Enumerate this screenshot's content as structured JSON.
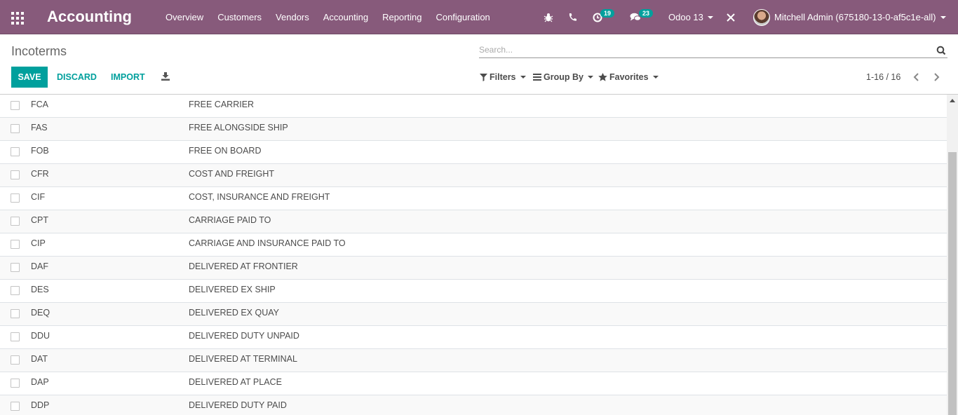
{
  "navbar": {
    "brand": "Accounting",
    "menu": [
      "Overview",
      "Customers",
      "Vendors",
      "Accounting",
      "Reporting",
      "Configuration"
    ],
    "activity_count": "19",
    "message_count": "23",
    "company": "Odoo 13",
    "user": "Mitchell Admin (675180-13-0-af5c1e-all)"
  },
  "control_panel": {
    "breadcrumb": "Incoterms",
    "search_placeholder": "Search...",
    "save_label": "SAVE",
    "discard_label": "DISCARD",
    "import_label": "IMPORT",
    "filters_label": "Filters",
    "groupby_label": "Group By",
    "favorites_label": "Favorites",
    "pager": "1-16 / 16"
  },
  "rows": [
    {
      "code": "FCA",
      "name": "FREE CARRIER"
    },
    {
      "code": "FAS",
      "name": "FREE ALONGSIDE SHIP"
    },
    {
      "code": "FOB",
      "name": "FREE ON BOARD"
    },
    {
      "code": "CFR",
      "name": "COST AND FREIGHT"
    },
    {
      "code": "CIF",
      "name": "COST, INSURANCE AND FREIGHT"
    },
    {
      "code": "CPT",
      "name": "CARRIAGE PAID TO"
    },
    {
      "code": "CIP",
      "name": "CARRIAGE AND INSURANCE PAID TO"
    },
    {
      "code": "DAF",
      "name": "DELIVERED AT FRONTIER"
    },
    {
      "code": "DES",
      "name": "DELIVERED EX SHIP"
    },
    {
      "code": "DEQ",
      "name": "DELIVERED EX QUAY"
    },
    {
      "code": "DDU",
      "name": "DELIVERED DUTY UNPAID"
    },
    {
      "code": "DAT",
      "name": "DELIVERED AT TERMINAL"
    },
    {
      "code": "DAP",
      "name": "DELIVERED AT PLACE"
    },
    {
      "code": "DDP",
      "name": "DELIVERED DUTY PAID"
    }
  ],
  "colors": {
    "navbar": "#875a7b",
    "primary": "#00a09d",
    "badge": "#00a09d"
  }
}
